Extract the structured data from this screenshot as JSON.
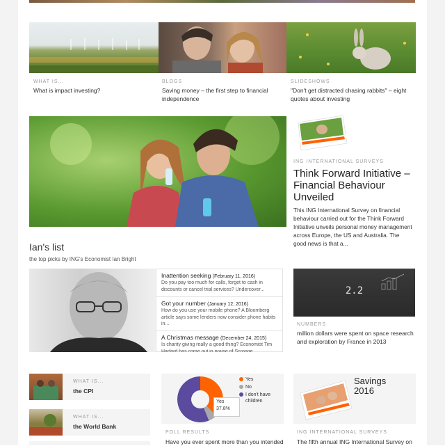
{
  "top_row": [
    {
      "kicker": "WHAT IS...",
      "title": "What is impact investing?",
      "image": "wind-turbines-landscape"
    },
    {
      "kicker": "BLOGS",
      "title": "Saving money – the first step to financial independence",
      "image": "couple-portrait"
    },
    {
      "kicker": "SLIDESHOWS",
      "title": "\"Don't get distracted chasing rabbits\" – eight quotes about investing",
      "image": "rabbit-in-grass"
    }
  ],
  "feature": {
    "kicker": "ING INTERNATIONAL SURVEYS",
    "title": "Think Forward Initiative – Financial Behaviour Unveiled",
    "body": "This ING International Survey on financial behaviour carried out for the Think Forward Initiative unveils personal money management across Europe, the US and Australia. The good news is that a..."
  },
  "ians_list": {
    "heading": "Ian's list",
    "subheading": "the top picks by ING's Economist Ian Bright",
    "items": [
      {
        "title": "Inattention seeking",
        "date": "(February 11, 2016)",
        "text": "Do you pay too much for calls, forget to cash in discounts or cancel trial services? Undercover..."
      },
      {
        "title": "Got your number",
        "date": "(January 12, 2016)",
        "text": "How do you use your mobile phone? A Bloomberg article says some lenders now consider phone habits in..."
      },
      {
        "title": "A Christmas message",
        "date": "(December 24, 2015)",
        "text": "Is charity giving really a good thing? Economist Tim Harford has come out in praise of Scrooge..."
      }
    ]
  },
  "numbers": {
    "kicker": "NUMBERS",
    "value": "2.2",
    "title": "million dollars were spent on space research and exploration by France in 2013"
  },
  "what_is_list": [
    {
      "kicker": "WHAT IS...",
      "title": "the CPI"
    },
    {
      "kicker": "WHAT IS...",
      "title": "the World Bank"
    }
  ],
  "poll": {
    "kicker": "POLL RESULTS",
    "question": "Have you ever spent more than you intended",
    "legend": [
      {
        "label": "Yes",
        "color": "#ff6200"
      },
      {
        "label": "No",
        "color": "#a8a8a8"
      },
      {
        "label": "I don't have children",
        "color": "#5b4a9e"
      }
    ],
    "tooltip_label": "Yes",
    "tooltip_value": "37.8%",
    "chart_data": {
      "type": "pie",
      "categories": [
        "Yes",
        "No",
        "I don't have children"
      ],
      "values": [
        37.8,
        6.0,
        56.2
      ]
    }
  },
  "savings": {
    "title_line1": "Savings",
    "title_line2": "2016",
    "kicker": "ING INTERNATIONAL SURVEYS",
    "text": "The fifth annual ING International Survey on"
  }
}
